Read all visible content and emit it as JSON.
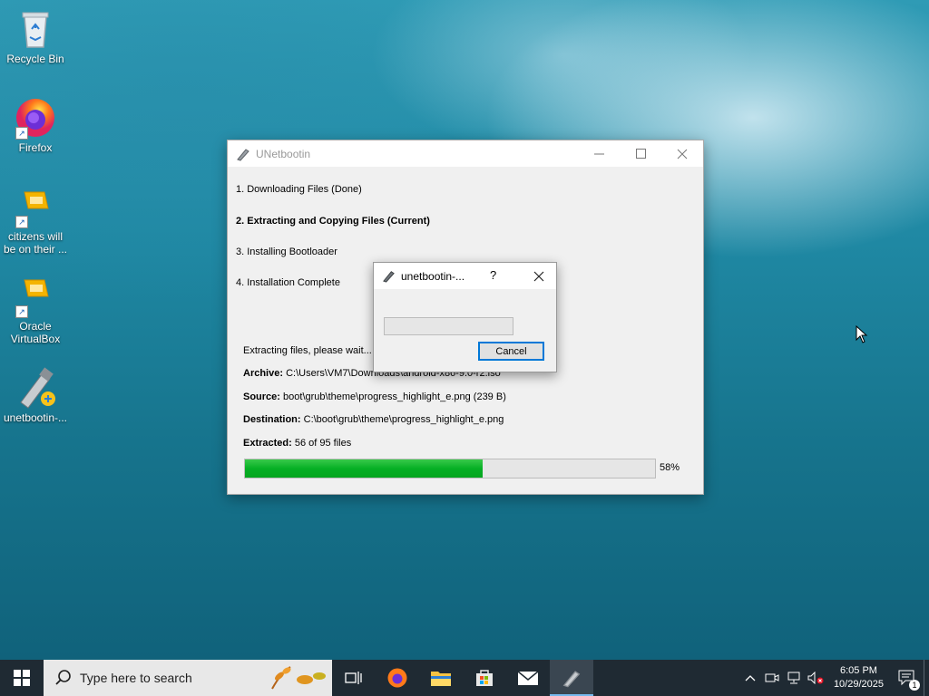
{
  "desktop": {
    "icons": [
      {
        "label": "Recycle Bin"
      },
      {
        "label": "Firefox"
      },
      {
        "label": "citizens will be on their ..."
      },
      {
        "label": "Oracle VirtualBox"
      },
      {
        "label": "unetbootin-..."
      }
    ]
  },
  "main_window": {
    "title": "UNetbootin",
    "steps": [
      "1. Downloading Files (Done)",
      "2. Extracting and Copying Files (Current)",
      "3. Installing Bootloader",
      "4. Installation Complete"
    ],
    "status_text": "Extracting files, please wait...",
    "archive_label": "Archive:",
    "archive_value": "C:\\Users\\VM7\\Downloads\\android-x86-9.0-r2.iso",
    "source_label": "Source:",
    "source_value": "boot\\grub\\theme\\progress_highlight_e.png (239 B)",
    "destination_label": "Destination:",
    "destination_value": "C:\\boot\\grub\\theme\\progress_highlight_e.png",
    "extracted_label": "Extracted:",
    "extracted_value": "56 of 95 files",
    "progress_percent": 58,
    "progress_text": "58%"
  },
  "dialog": {
    "title": "unetbootin-...",
    "help": "?",
    "cancel_label": "Cancel"
  },
  "taskbar": {
    "search_placeholder": "Type here to search",
    "time": "6:05 PM",
    "date": "10/29/2025",
    "notification_count": "1"
  },
  "colors": {
    "progress_fill": "#06b025",
    "taskbar_bg": "#1f2a33",
    "accent": "#0078d7"
  }
}
